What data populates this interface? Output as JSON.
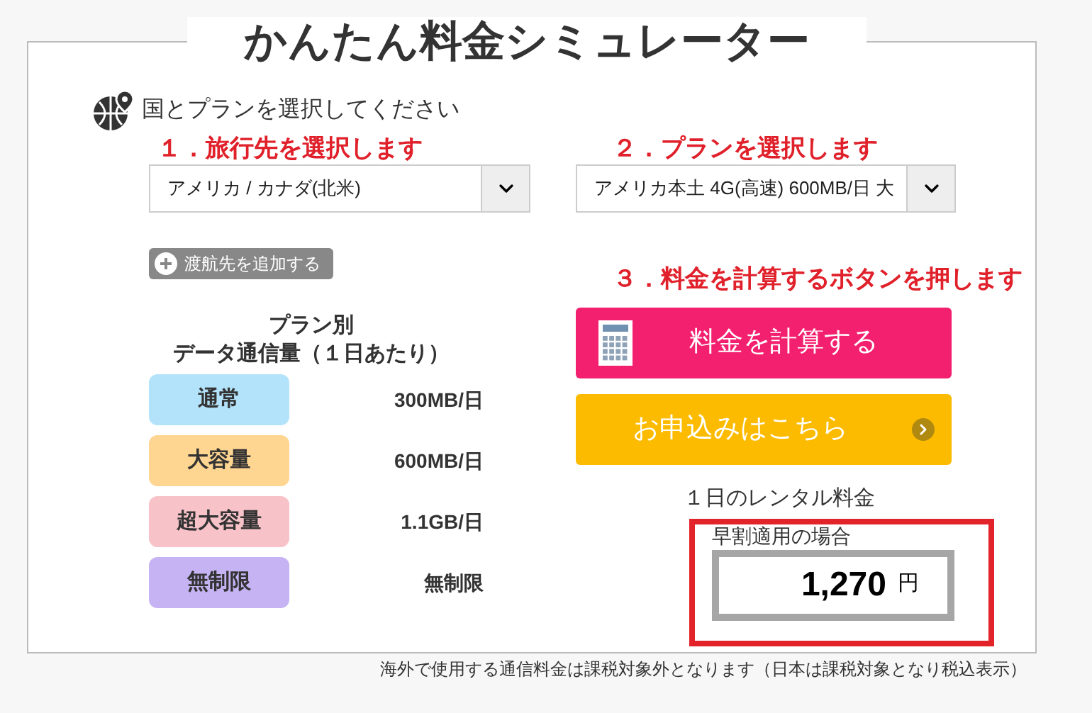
{
  "title": "かんたん料金シミュレーター",
  "intro": "国とプランを選択してください",
  "steps": [
    {
      "label": "１．旅行先を選択します",
      "select_value": "アメリカ / カナダ(北米)"
    },
    {
      "label": "２．プランを選択します",
      "select_value": "アメリカ本土 4G(高速) 600MB/日 大"
    }
  ],
  "add_destination_button": "渡航先を追加する",
  "plan_table": {
    "heading": "プラン別",
    "subheading": "データ通信量（１日あたり）",
    "rows": [
      {
        "name": "通常",
        "amount": "300MB/日",
        "color": "#b3e3fb"
      },
      {
        "name": "大容量",
        "amount": "600MB/日",
        "color": "#fed591"
      },
      {
        "name": "超大容量",
        "amount": "1.1GB/日",
        "color": "#f8c3c8"
      },
      {
        "name": "無制限",
        "amount": "無制限",
        "color": "#c6b3f4"
      }
    ]
  },
  "step3_label": "３．料金を計算するボタンを押します",
  "calculate_button": "料金を計算する",
  "apply_button": "お申込みはこちら",
  "result": {
    "caption": "１日のレンタル料金",
    "note": "早割適用の場合",
    "amount": "1,270",
    "unit": "円"
  },
  "footnote": "海外で使用する通信料金は課税対象外となります（日本は課税対象となり税込表示）"
}
